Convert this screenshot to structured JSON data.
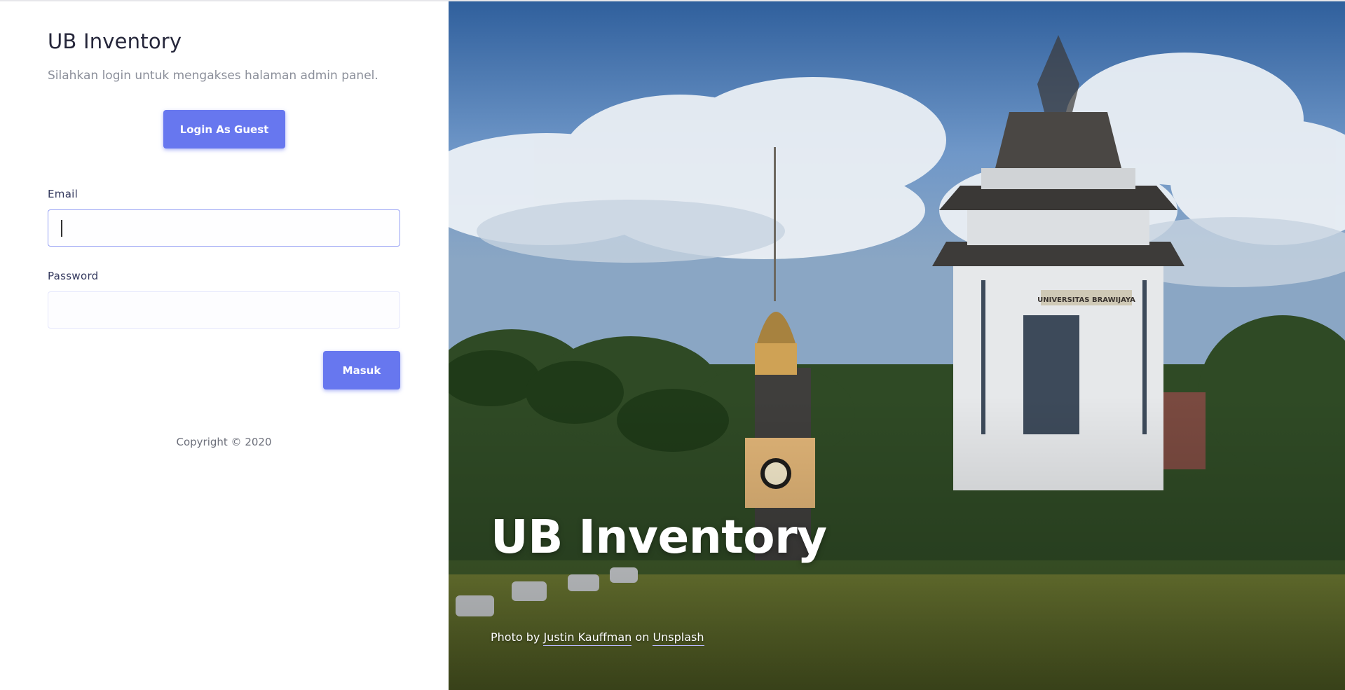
{
  "login": {
    "title": "UB Inventory",
    "subtitle": "Silahkan login untuk mengakses halaman admin panel.",
    "guest_button": "Login As Guest",
    "email_label": "Email",
    "email_value": "",
    "password_label": "Password",
    "password_value": "",
    "submit_button": "Masuk",
    "copyright": "Copyright © 2020"
  },
  "hero": {
    "title": "UB Inventory",
    "credit_prefix": "Photo by",
    "credit_author": "Justin Kauffman",
    "credit_middle": "on",
    "credit_site": "Unsplash",
    "building_sign": "UNIVERSITAS BRAWIJAYA"
  },
  "colors": {
    "accent": "#6777ef",
    "title_text": "#25263a",
    "muted_text": "#8b8f9a"
  }
}
